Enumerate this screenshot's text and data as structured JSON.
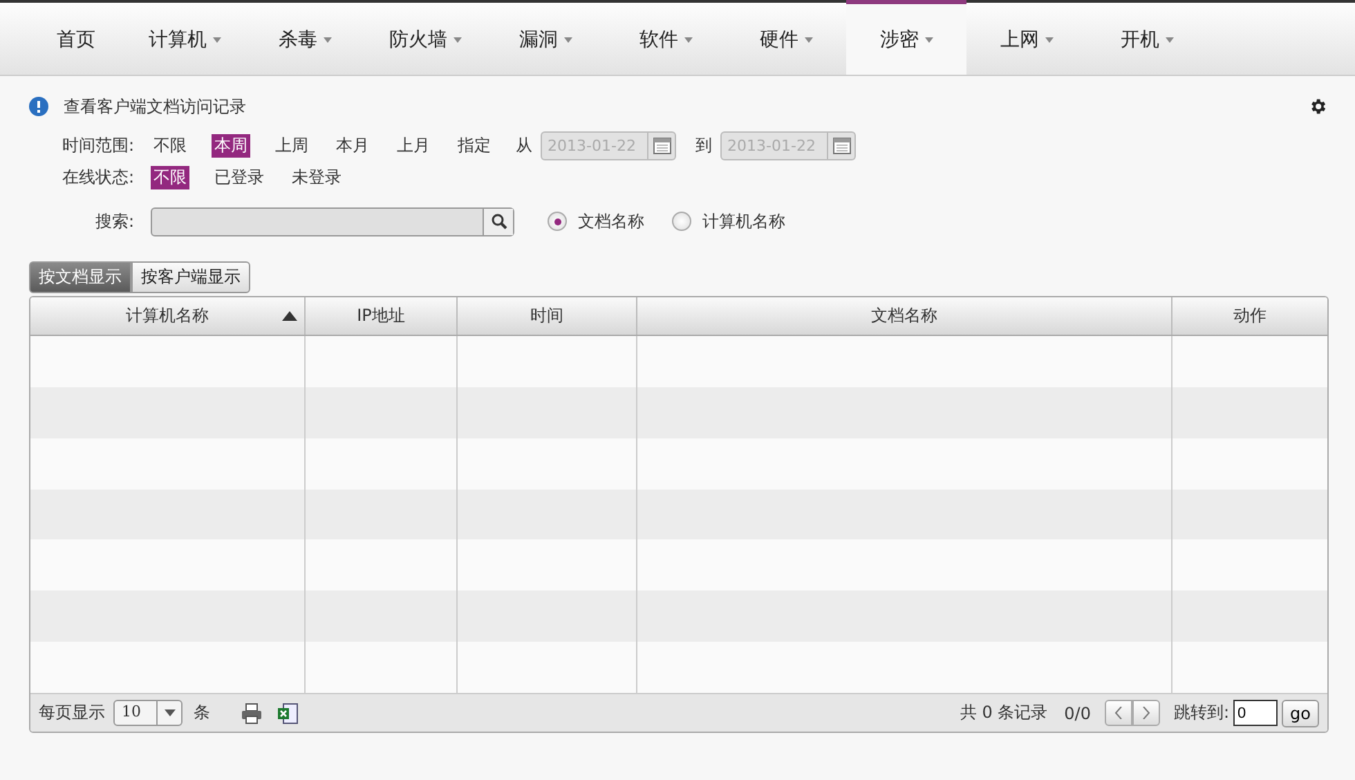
{
  "nav": {
    "tabs": [
      {
        "label": "首页",
        "has_menu": false,
        "selected": false
      },
      {
        "label": "计算机",
        "has_menu": true,
        "selected": false
      },
      {
        "label": "杀毒",
        "has_menu": true,
        "selected": false
      },
      {
        "label": "防火墙",
        "has_menu": true,
        "selected": false
      },
      {
        "label": "漏洞",
        "has_menu": true,
        "selected": false
      },
      {
        "label": "软件",
        "has_menu": true,
        "selected": false
      },
      {
        "label": "硬件",
        "has_menu": true,
        "selected": false
      },
      {
        "label": "涉密",
        "has_menu": true,
        "selected": true
      },
      {
        "label": "上网",
        "has_menu": true,
        "selected": false
      },
      {
        "label": "开机",
        "has_menu": true,
        "selected": false
      }
    ]
  },
  "notice": "查看客户端文档访问记录",
  "time_range": {
    "label": "时间范围:",
    "options": [
      {
        "label": "不限",
        "selected": false
      },
      {
        "label": "本周",
        "selected": true
      },
      {
        "label": "上周",
        "selected": false
      },
      {
        "label": "本月",
        "selected": false
      },
      {
        "label": "上月",
        "selected": false
      },
      {
        "label": "指定",
        "selected": false
      }
    ],
    "from_label": "从",
    "from_value": "2013-01-22",
    "to_label": "到",
    "to_value": "2013-01-22",
    "dates_disabled": true
  },
  "online_status": {
    "label": "在线状态:",
    "options": [
      {
        "label": "不限",
        "selected": true
      },
      {
        "label": "已登录",
        "selected": false
      },
      {
        "label": "未登录",
        "selected": false
      }
    ]
  },
  "search": {
    "label": "搜索:",
    "scopes": [
      {
        "label": "文档名称",
        "selected": true
      },
      {
        "label": "计算机名称",
        "selected": false
      }
    ]
  },
  "view_tabs": [
    {
      "label": "按文档显示",
      "selected": true
    },
    {
      "label": "按客户端显示",
      "selected": false
    }
  ],
  "table": {
    "columns": [
      {
        "label": "计算机名称",
        "sorted": true
      },
      {
        "label": "IP地址",
        "sorted": false
      },
      {
        "label": "时间",
        "sorted": false
      },
      {
        "label": "文档名称",
        "sorted": false
      },
      {
        "label": "动作",
        "sorted": false
      }
    ]
  },
  "pager": {
    "per_page_label": "每页显示",
    "per_page_value": "10",
    "unit": "条",
    "total": "共 0 条记录",
    "pages": "0/0",
    "jump_label": "跳转到:",
    "jump_value": "0",
    "go": "go"
  }
}
